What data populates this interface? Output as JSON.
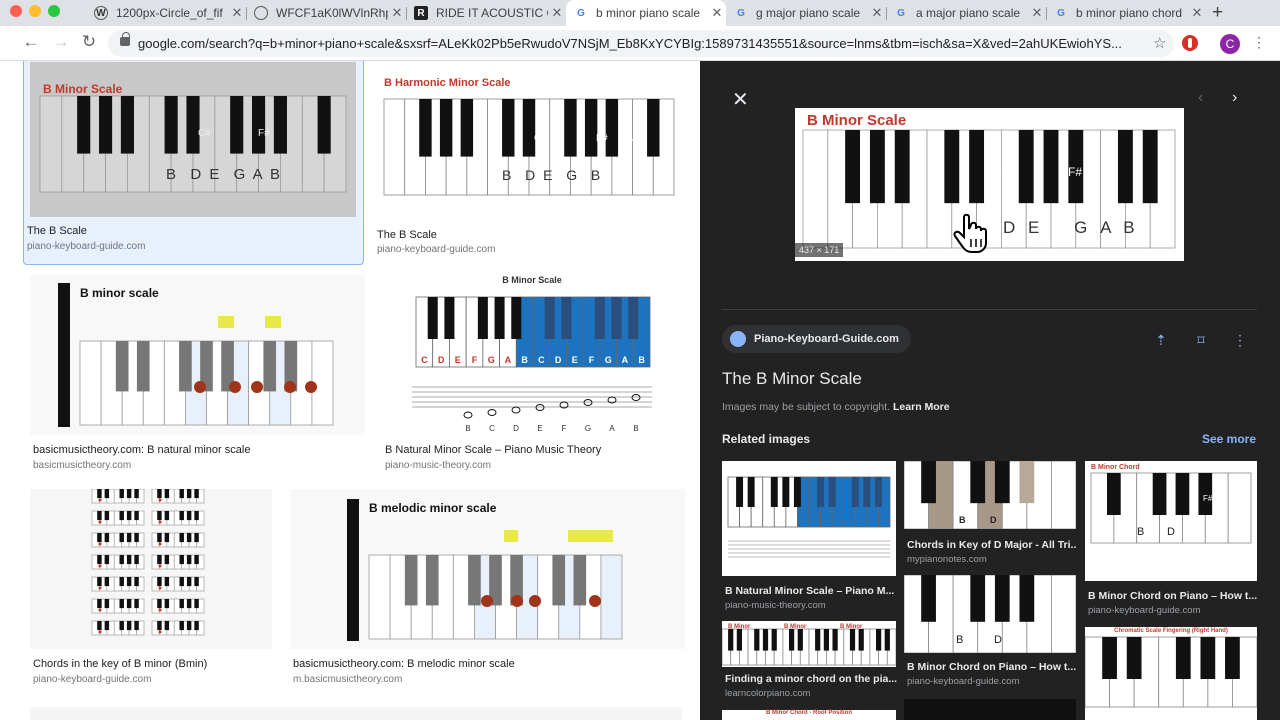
{
  "browser": {
    "tabs": [
      {
        "title": "1200px-Circle_of_fif",
        "fav": "wiki",
        "active": false
      },
      {
        "title": "WFCF1aK0lWVlnRhp",
        "fav": "globe",
        "active": false
      },
      {
        "title": "RIDE IT ACOUSTIC C",
        "fav": "dark",
        "active": false
      },
      {
        "title": "b minor piano scale",
        "fav": "google",
        "active": true
      },
      {
        "title": "g major piano scale",
        "fav": "google",
        "active": false
      },
      {
        "title": "a major piano scale",
        "fav": "google",
        "active": false
      },
      {
        "title": "b minor piano chord",
        "fav": "google",
        "active": false
      }
    ],
    "new_tab": "+",
    "url": "google.com/search?q=b+minor+piano+scale&sxsrf=ALeKk02Pb5eRwudoV7NSjM_Eb8KxYCYBIg:1589731435551&source=lnms&tbm=isch&sa=X&ved=2ahUKEwiohYS...",
    "avatar": "C"
  },
  "results": [
    {
      "caption": "The B Scale",
      "source": "piano-keyboard-guide.com",
      "selected": true,
      "thumb": {
        "title": "B Minor Scale",
        "notes": "B  D E  G A B",
        "sharps": [
          "C#",
          "F#"
        ]
      }
    },
    {
      "caption": "The B Scale",
      "source": "piano-keyboard-guide.com",
      "selected": false,
      "thumb": {
        "title": "B Harmonic Minor Scale",
        "notes": "B  D E  G  B",
        "sharps": [
          "C#",
          "F#",
          "A#"
        ]
      }
    },
    {
      "caption": "basicmusictheory.com: B natural minor scale",
      "source": "basicmusictheory.com",
      "selected": false,
      "thumb": {
        "title": "B minor scale",
        "brand": "basicmusictheory.com"
      }
    },
    {
      "caption": "B Natural Minor Scale – Piano Music Theory",
      "source": "piano-music-theory.com",
      "selected": false,
      "thumb": {
        "title": "B Minor Scale",
        "letters": [
          "C",
          "D",
          "E",
          "F",
          "G",
          "A",
          "B",
          "C",
          "D",
          "E",
          "F",
          "G",
          "A",
          "B"
        ],
        "staff_letters": [
          "B",
          "C",
          "D",
          "E",
          "F",
          "G",
          "A",
          "B"
        ]
      }
    },
    {
      "caption": "Chords in the key of B minor (Bmin)",
      "source": "piano-keyboard-guide.com",
      "selected": false,
      "thumb": {}
    },
    {
      "caption": "basicmusictheory.com: B melodic minor scale",
      "source": "m.basicmusictheory.com",
      "selected": false,
      "thumb": {
        "title": "B melodic minor scale",
        "brand": "basicmusictheory.com"
      }
    }
  ],
  "panel": {
    "preview_title": "B Minor Scale",
    "preview_notes": [
      "D",
      "E",
      "G",
      "A",
      "B"
    ],
    "preview_sharps": [
      "C#",
      "F#"
    ],
    "dimensions": "437 × 171",
    "site": "Piano-Keyboard-Guide.com",
    "title": "The B Minor Scale",
    "copyright": "Images may be subject to copyright.",
    "learn_more": "Learn More",
    "related_heading": "Related images",
    "see_more": "See more",
    "related": [
      {
        "caption": "B Natural Minor Scale – Piano M...",
        "source": "piano-music-theory.com"
      },
      {
        "caption": "Chords in Key of D Major - All Tri...",
        "source": "mypianonotes.com"
      },
      {
        "caption": "B Minor Chord on Piano – How t...",
        "source": "piano-keyboard-guide.com"
      },
      {
        "caption": "Finding a minor chord on the pia...",
        "source": "learncolorpiano.com"
      },
      {
        "caption": "B Minor Chord on Piano – How t...",
        "source": "piano-keyboard-guide.com"
      },
      {
        "caption": "",
        "source": ""
      }
    ],
    "related_labels": {
      "b_minor_chord": "B Minor Chord",
      "chromatic": "Chromatic Scale Fingering (Right Hand)",
      "chord_notes": [
        "B",
        "D"
      ],
      "chord_sharp": "F#",
      "finding_notes": [
        "B Minor",
        "B Minor",
        "B Minor"
      ],
      "root_pos": "B Minor Chord - Root Position"
    }
  },
  "colors": {
    "selected_border": "#8ab4f8",
    "accent_blue": "#1a73e8",
    "scale_red": "#c0392b",
    "panel_bg": "#222222"
  }
}
